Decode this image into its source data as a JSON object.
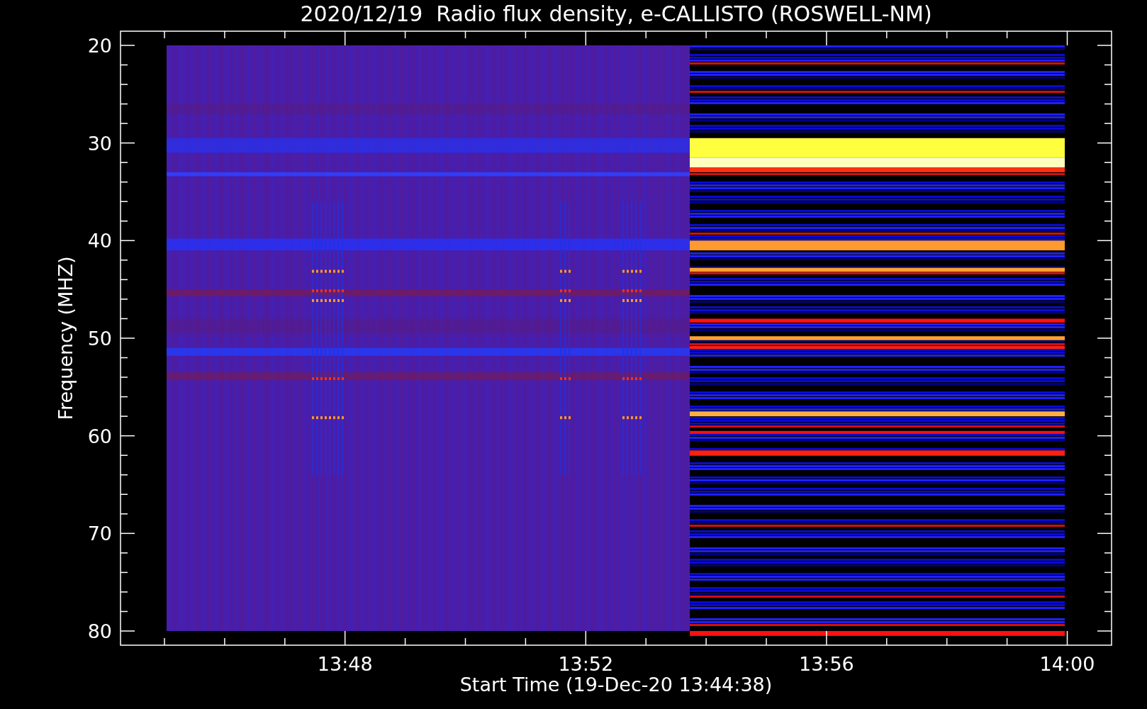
{
  "title": "2020/12/19  Radio flux density, e-CALLISTO (ROSWELL-NM)",
  "y_axis": {
    "label": "Frequency (MHZ)",
    "ticks": [
      "20",
      "30",
      "40",
      "50",
      "60",
      "70",
      "80"
    ]
  },
  "x_axis": {
    "label": "Start Time (19-Dec-20 13:44:38)",
    "ticks": [
      "13:48",
      "13:52",
      "13:56",
      "14:00"
    ]
  }
}
